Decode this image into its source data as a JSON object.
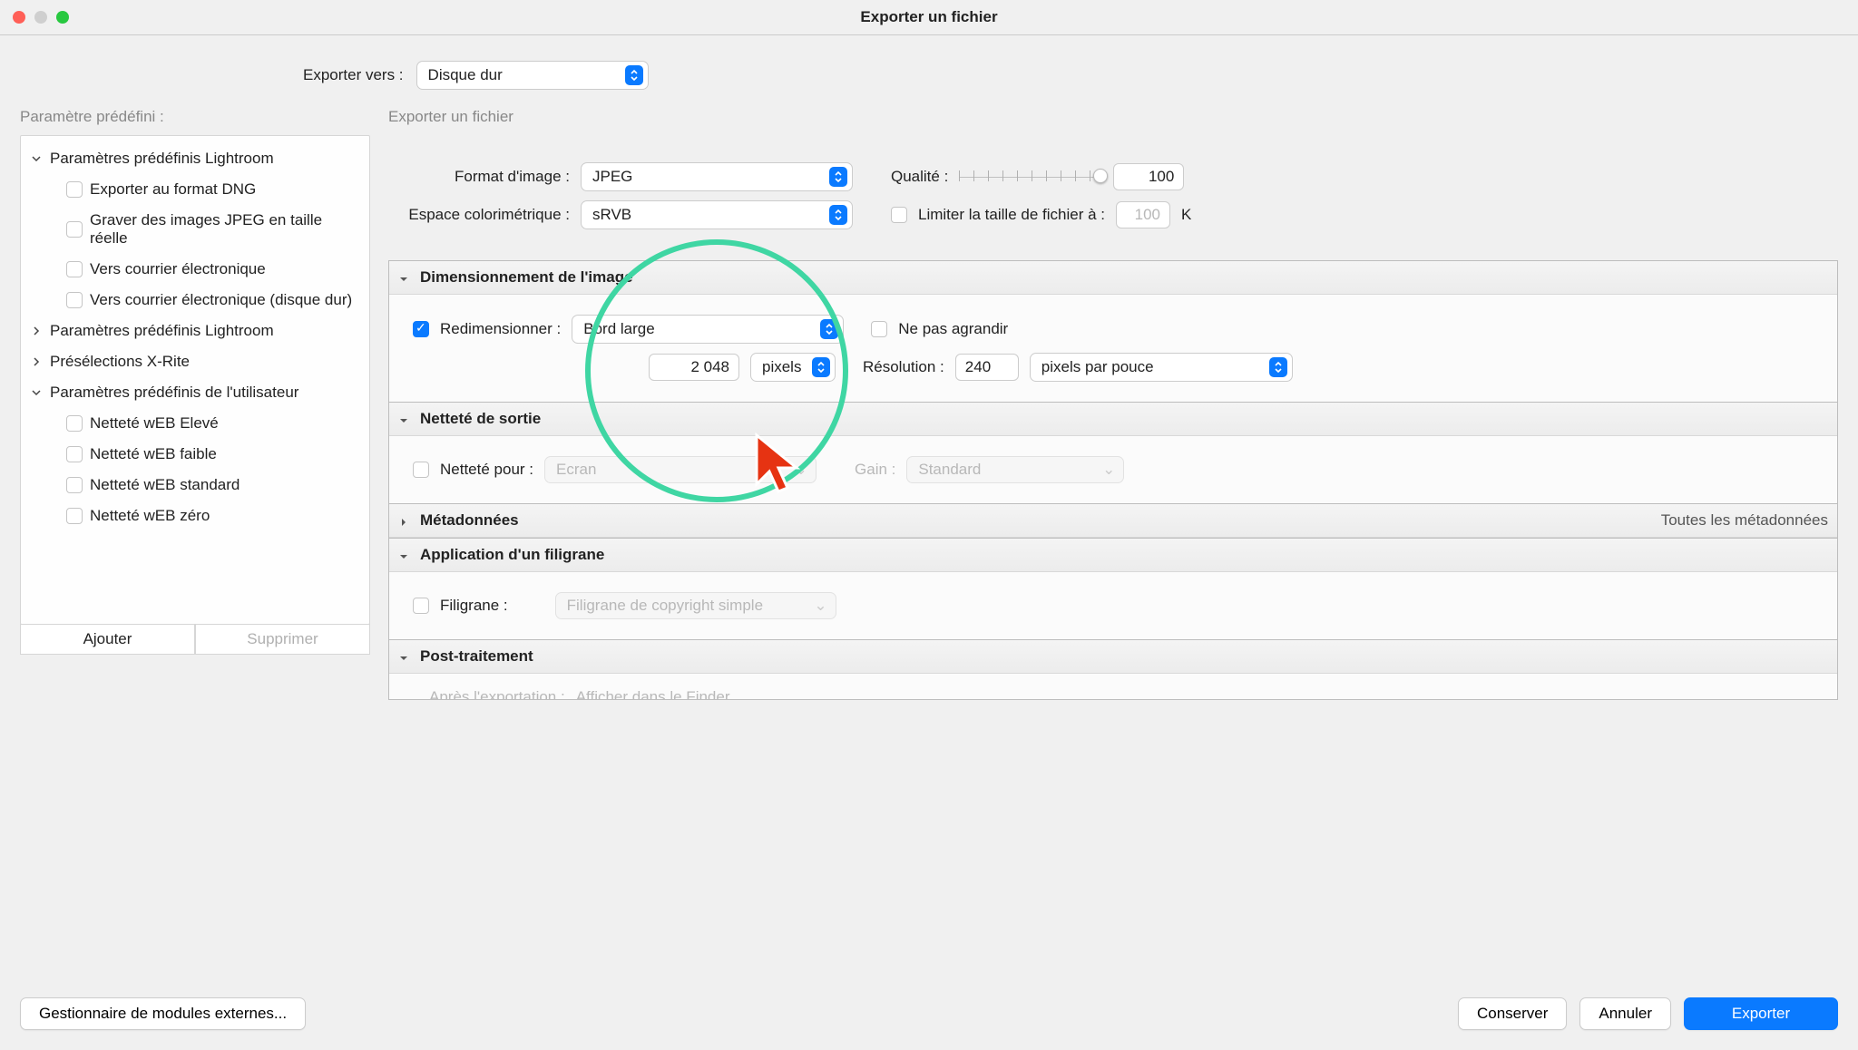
{
  "window": {
    "title": "Exporter un fichier"
  },
  "topbar": {
    "label": "Exporter vers :",
    "value": "Disque dur"
  },
  "sidebar": {
    "heading": "Paramètre prédéfini :",
    "groups": [
      {
        "label": "Paramètres prédéfinis Lightroom",
        "expanded": true,
        "items": [
          "Exporter au format DNG",
          "Graver des images JPEG en taille réelle",
          "Vers courrier électronique",
          "Vers courrier électronique (disque dur)"
        ]
      },
      {
        "label": "Paramètres prédéfinis Lightroom",
        "expanded": false
      },
      {
        "label": "Présélections X-Rite",
        "expanded": false
      },
      {
        "label": "Paramètres prédéfinis de l'utilisateur",
        "expanded": true,
        "items": [
          "Netteté wEB Elevé",
          "Netteté wEB faible",
          "Netteté wEB standard",
          "Netteté wEB zéro"
        ]
      }
    ],
    "add": "Ajouter",
    "remove": "Supprimer"
  },
  "main": {
    "heading": "Exporter un fichier",
    "file": {
      "format_label": "Format d'image :",
      "format_value": "JPEG",
      "quality_label": "Qualité :",
      "quality_value": "100",
      "colorspace_label": "Espace colorimétrique :",
      "colorspace_value": "sRVB",
      "limit_label": "Limiter la taille de fichier à :",
      "limit_value": "100",
      "limit_unit": "K"
    },
    "sizing": {
      "header": "Dimensionnement de l'image",
      "resize_label": "Redimensionner :",
      "resize_value": "Bord large",
      "noenlarge_label": "Ne pas agrandir",
      "dimension_value": "2 048",
      "unit_value": "pixels",
      "resolution_label": "Résolution :",
      "resolution_value": "240",
      "resolution_unit": "pixels par pouce"
    },
    "sharpen": {
      "header": "Netteté de sortie",
      "for_label": "Netteté pour :",
      "for_value": "Ecran",
      "gain_label": "Gain :",
      "gain_value": "Standard"
    },
    "metadata": {
      "header": "Métadonnées",
      "aux": "Toutes les métadonnées"
    },
    "watermark": {
      "header": "Application d'un filigrane",
      "label": "Filigrane :",
      "value": "Filigrane de copyright simple"
    },
    "post": {
      "header": "Post-traitement",
      "after_label": "Après l'exportation :",
      "after_value": "Afficher dans le Finder"
    }
  },
  "footer": {
    "plugin_mgr": "Gestionnaire de modules externes...",
    "save": "Conserver",
    "cancel": "Annuler",
    "export": "Exporter"
  }
}
